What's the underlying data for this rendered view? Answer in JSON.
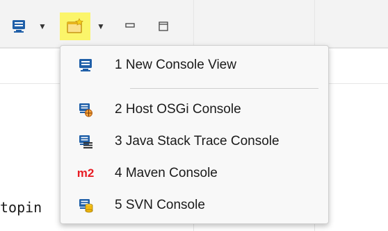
{
  "editor": {
    "partial_text": "topin"
  },
  "toolbar": {
    "items": [
      {
        "icon": "monitor-icon"
      },
      {
        "icon": "chevron-down-icon"
      },
      {
        "icon": "new-console-view-icon",
        "highlighted": true,
        "highlight_color": "#fbf56a"
      },
      {
        "icon": "chevron-down-icon"
      },
      {
        "icon": "minimize-icon"
      },
      {
        "icon": "maximize-icon"
      }
    ]
  },
  "menu": {
    "items": [
      {
        "label": "1 New Console View",
        "icon": "monitor-icon"
      },
      {
        "label": "2 Host OSGi Console",
        "icon": "osgi-console-icon"
      },
      {
        "label": "3 Java Stack Trace Console",
        "icon": "stack-trace-console-icon"
      },
      {
        "label": "4 Maven Console",
        "icon": "maven-m2-icon",
        "icon_text": "m2"
      },
      {
        "label": "5 SVN Console",
        "icon": "svn-console-icon"
      }
    ]
  },
  "colors": {
    "monitor_blue": "#1f5fa8",
    "maven_red": "#e81c24",
    "svn_yellow": "#f2b90f",
    "folder_yellow": "#e8b51c"
  }
}
